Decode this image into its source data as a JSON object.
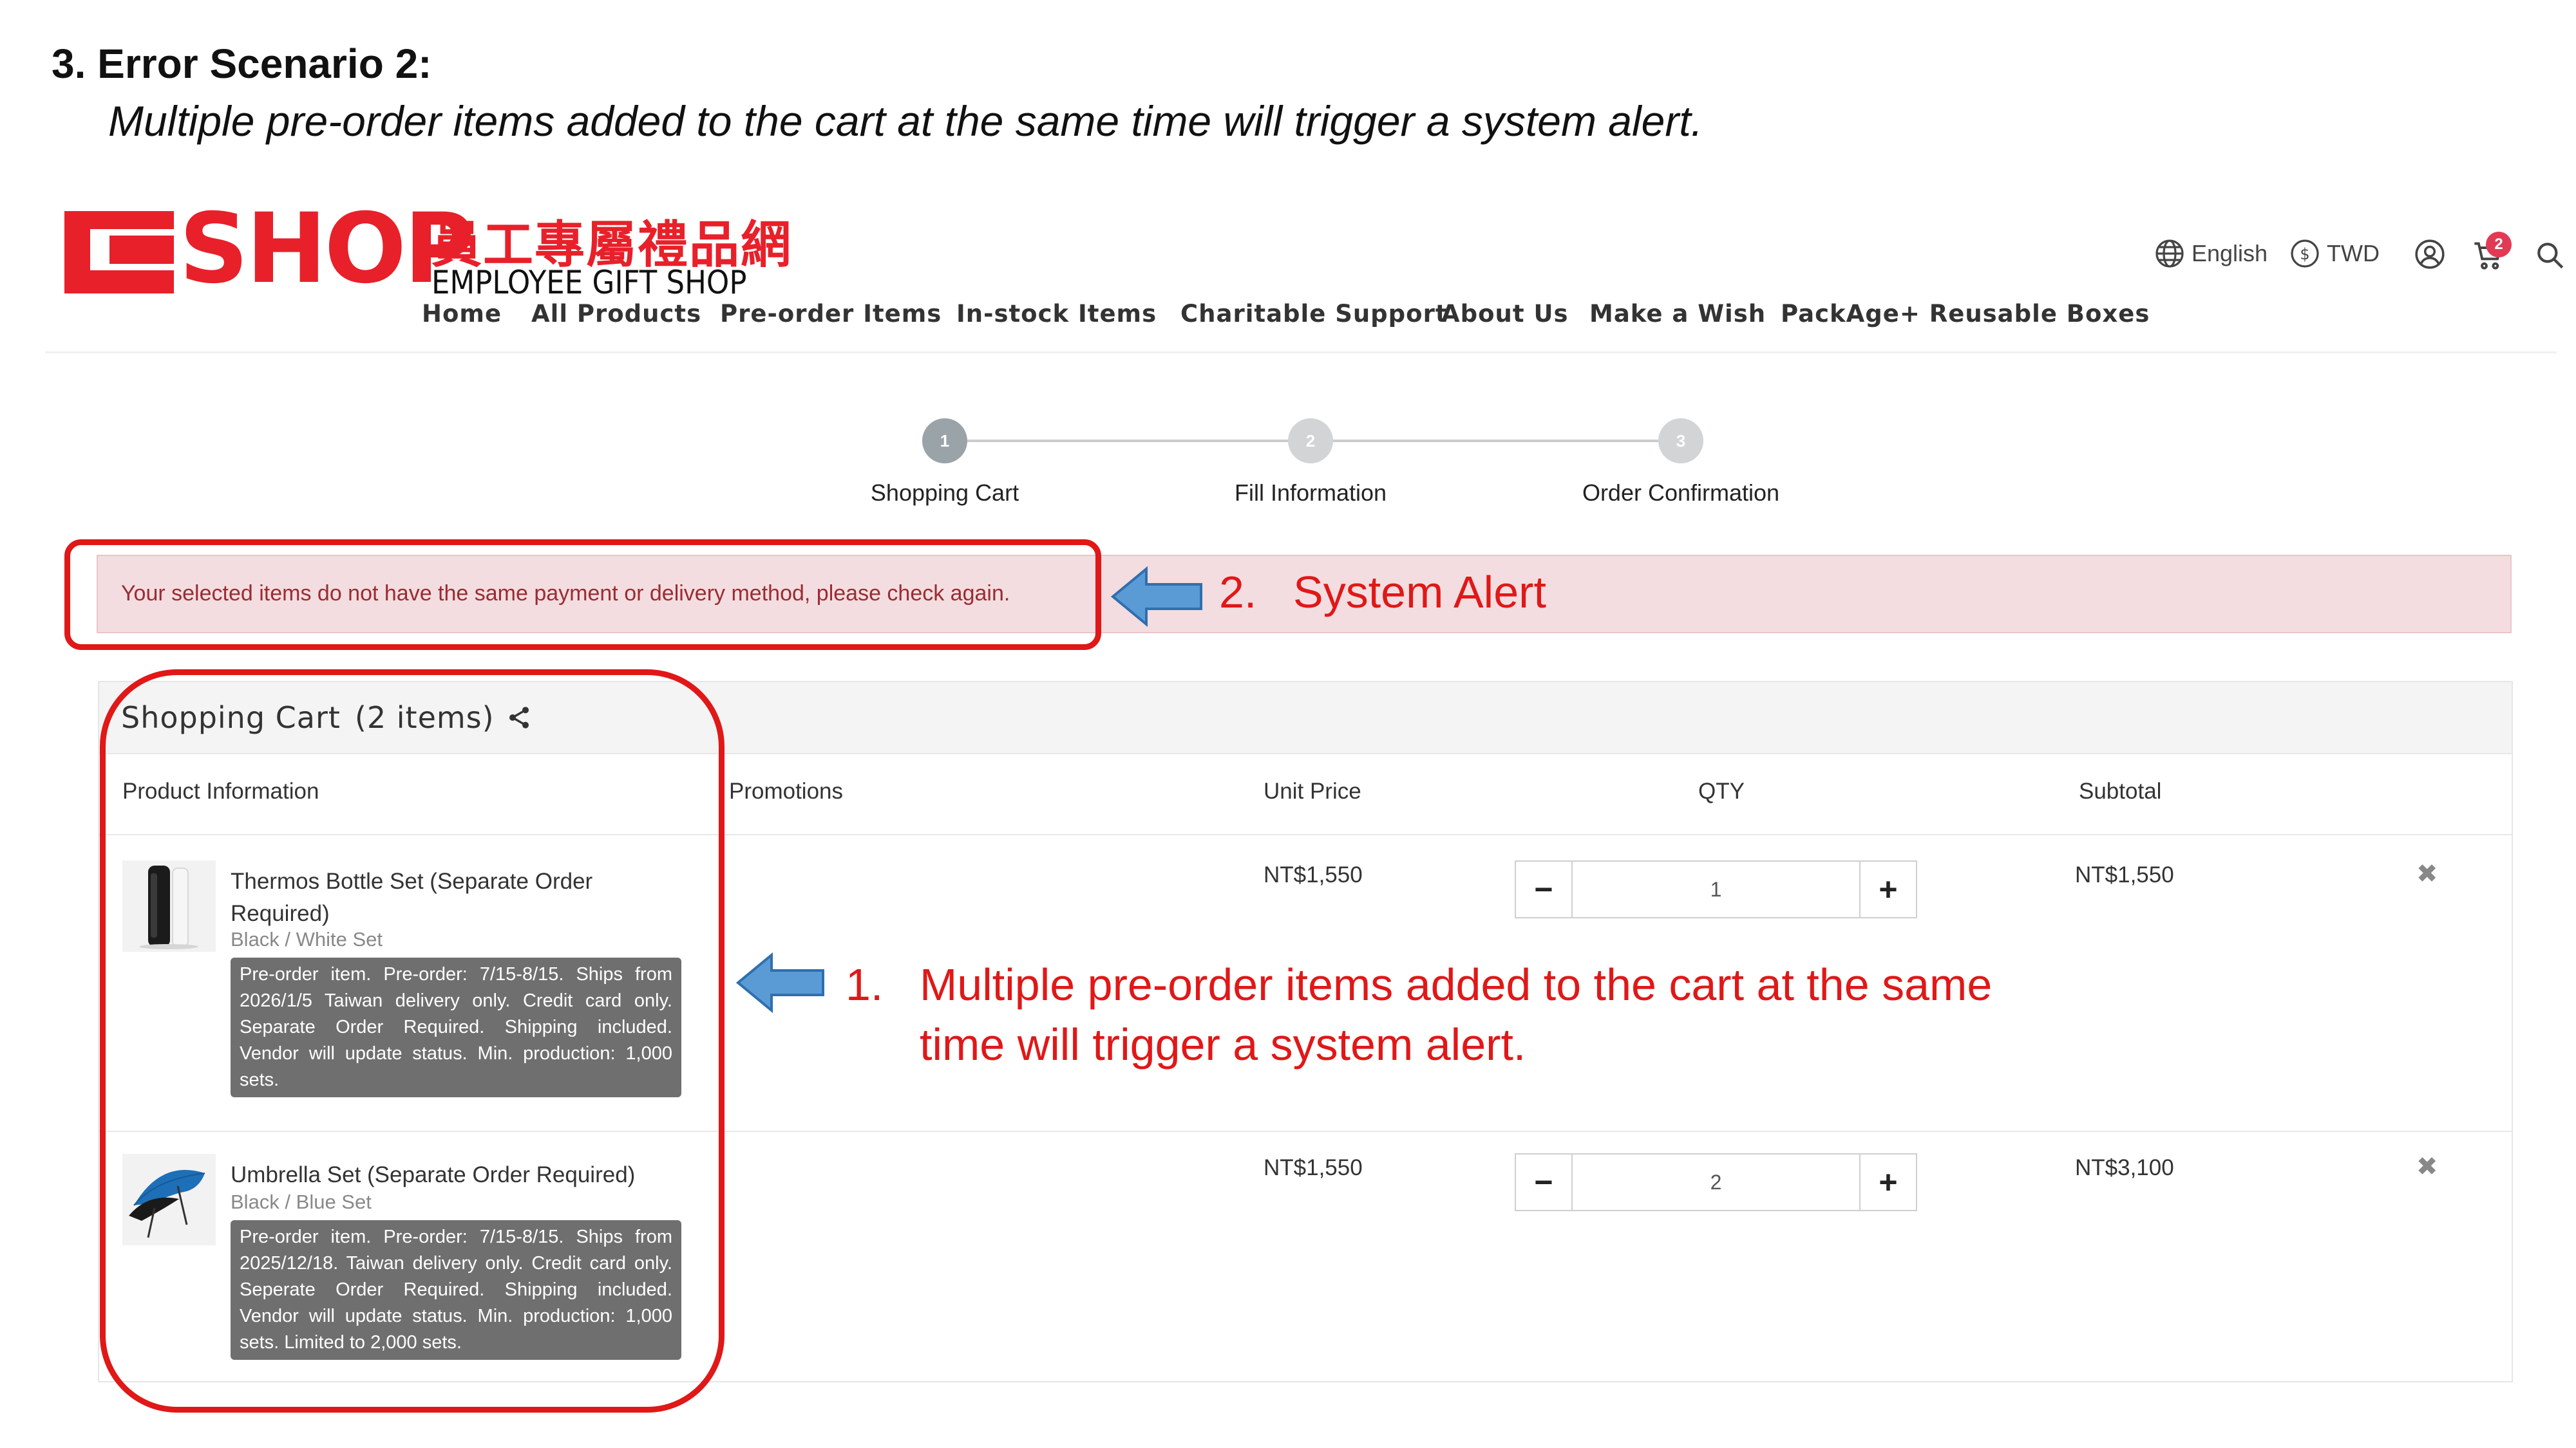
{
  "slide": {
    "title": "3. Error Scenario 2:",
    "subtitle": "Multiple pre-order items added to the cart at the same time will trigger a system alert."
  },
  "brand": {
    "logo_text": "SHOP",
    "name_cn": "員工專屬禮品網",
    "name_en": "EMPLOYEE GIFT SHOP",
    "primary_color": "#e8202a"
  },
  "nav": [
    "Home",
    "All Products",
    "Pre-order Items",
    "In-stock Items",
    "Charitable Support",
    "About Us",
    "Make a Wish",
    "PackAge+ Reusable Boxes"
  ],
  "utility": {
    "language": "English",
    "currency": "TWD",
    "cart_count": "2",
    "icons": [
      "globe-icon",
      "dollar-icon",
      "user-icon",
      "cart-icon",
      "search-icon"
    ]
  },
  "stepper": [
    {
      "number": "1",
      "label": "Shopping Cart"
    },
    {
      "number": "2",
      "label": "Fill Information"
    },
    {
      "number": "3",
      "label": "Order Confirmation"
    }
  ],
  "alert": {
    "message": "Your selected items do not have the same payment or delivery method, please check again."
  },
  "annotations": {
    "alert_num": "2.",
    "alert_label": "System Alert",
    "items_num": "1.",
    "items_line1": "Multiple pre-order items added to the cart at the same",
    "items_line2": "time will trigger a system alert.",
    "color": "#e01818"
  },
  "cart": {
    "title": "Shopping Cart",
    "count_label": "(2 items)",
    "columns": [
      "Product Information",
      "Promotions",
      "Unit Price",
      "QTY",
      "Subtotal"
    ],
    "items": [
      {
        "name": "Thermos Bottle Set (Separate Order Required)",
        "variant": "Black / White Set",
        "note": "Pre-order item. Pre-order: 7/15-8/15. Ships from 2026/1/5 Taiwan delivery only. Credit card only. Separate Order Required. Shipping included. Vendor will update status. Min. production: 1,000 sets.",
        "unit_price": "NT$1,550",
        "qty": "1",
        "subtotal": "NT$1,550"
      },
      {
        "name": "Umbrella Set (Separate Order Required)",
        "variant": "Black / Blue Set",
        "note": "Pre-order item. Pre-order: 7/15-8/15. Ships from 2025/12/18. Taiwan delivery only. Credit card only. Seperate Order Required. Shipping included. Vendor will update status. Min. production: 1,000 sets. Limited to 2,000 sets.",
        "unit_price": "NT$1,550",
        "qty": "2",
        "subtotal": "NT$3,100"
      }
    ],
    "minus_label": "−",
    "plus_label": "+",
    "remove_label": "✖"
  }
}
